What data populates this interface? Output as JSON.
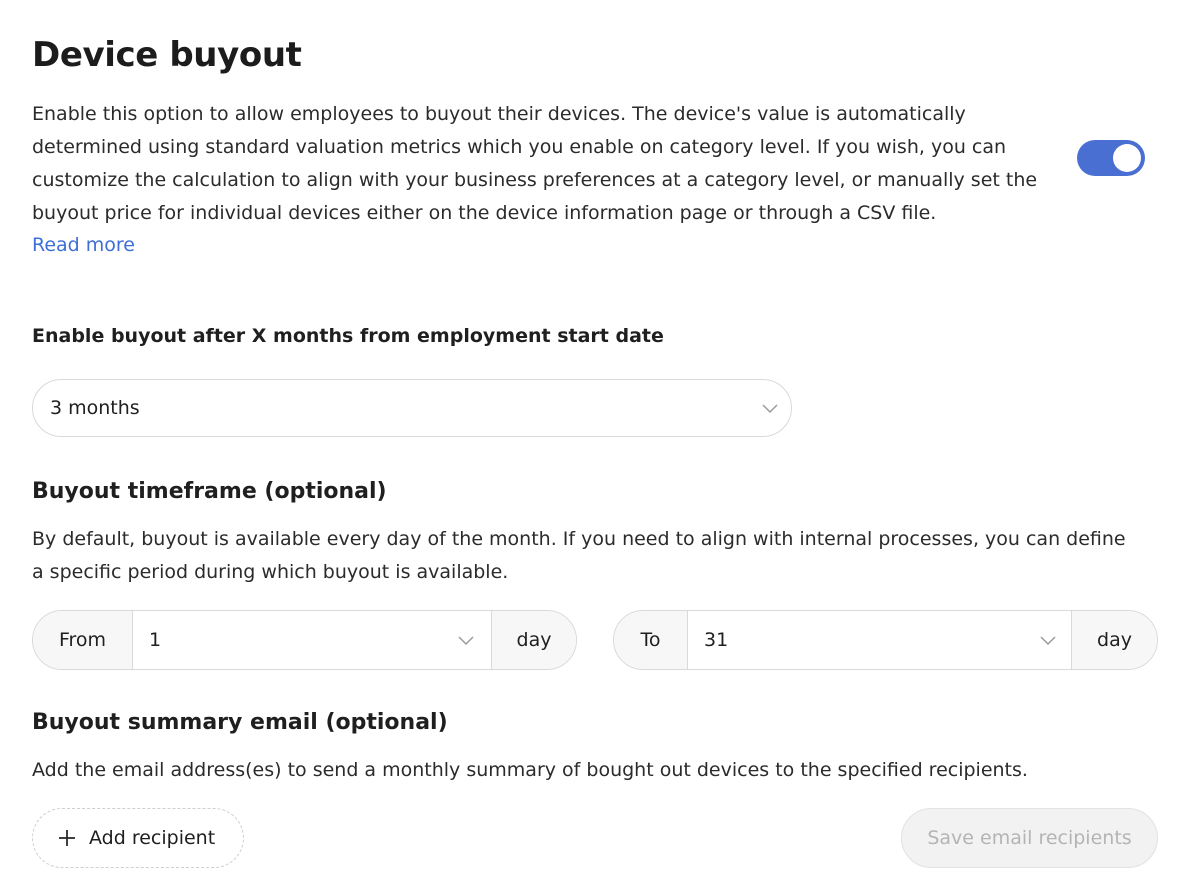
{
  "header": {
    "title": "Device buyout",
    "description": "Enable this option to allow employees to buyout their devices. The device's value is automatically determined using standard valuation metrics which you enable on category level. If you wish, you can customize the calculation to align with your business preferences at a category level, or manually set the buyout price for individual devices either on the device information page or through a CSV file.",
    "read_more": "Read more",
    "toggle_enabled": true
  },
  "employment": {
    "label": "Enable buyout after X months from employment start date",
    "selected": "3 months",
    "icon": "chevron-down-icon"
  },
  "timeframe": {
    "title": "Buyout timeframe (optional)",
    "description": "By default, buyout is available every day of the month. If you need to align with internal processes, you can define a specific period during which buyout is available.",
    "from": {
      "prefix": "From",
      "value": "1",
      "suffix": "day"
    },
    "to": {
      "prefix": "To",
      "value": "31",
      "suffix": "day"
    }
  },
  "summary_email": {
    "title": "Buyout summary email (optional)",
    "description": "Add the email address(es) to send a monthly summary of bought out devices to the specified recipients.",
    "add_button": "Add recipient",
    "add_icon": "plus-icon",
    "save_button": "Save email recipients",
    "save_disabled": true
  },
  "colors": {
    "accent": "#4a6fd3",
    "link": "#3d6fd6",
    "border": "#d9d9d9",
    "disabled_text": "#b4b4b4"
  }
}
